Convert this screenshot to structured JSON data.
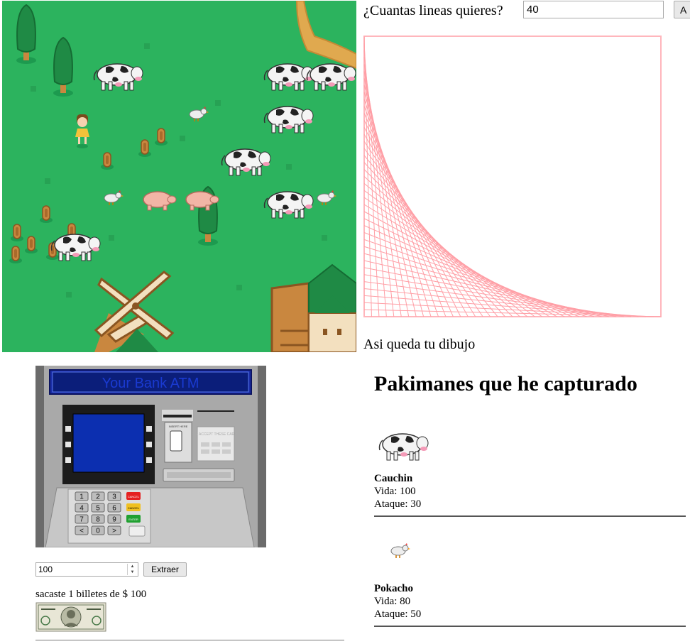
{
  "drawing_form": {
    "question": "¿Cuantas lineas quieres?",
    "lines_value": "40",
    "button_label": "A",
    "caption": "Asi queda tu dibujo",
    "line_color": "#ff9fa6"
  },
  "atm": {
    "screen_title": "Your Bank ATM",
    "insert_label": "INSERT HERE",
    "cards_label": "WE ACCEPT THESE CARDS",
    "keys": [
      "1",
      "2",
      "3",
      "4",
      "5",
      "6",
      "7",
      "8",
      "9",
      "<",
      "0",
      ">"
    ],
    "function_keys": [
      "CANCEL",
      "CANCEL",
      "ENTER"
    ],
    "amount_value": "100",
    "extract_button": "Extraer",
    "withdraw_message": "sacaste 1 billetes de $ 100"
  },
  "pakimanes": {
    "title": "Pakimanes que he capturado",
    "items": [
      {
        "name": "Cauchin",
        "vida": "Vida: 100",
        "ataque": "Ataque: 30",
        "kind": "cow-icon"
      },
      {
        "name": "Pokacho",
        "vida": "Vida: 80",
        "ataque": "Ataque: 50",
        "kind": "chicken-icon"
      }
    ]
  }
}
